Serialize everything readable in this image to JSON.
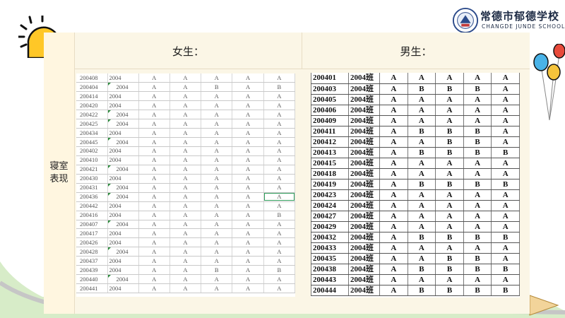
{
  "logo": {
    "name_cn": "常德市郁德学校",
    "name_en": "CHANGDE JUNDE SCHOOL"
  },
  "row_label": "寝室表现",
  "headers": {
    "female": "女生：",
    "male": "男生："
  },
  "female_table": {
    "rows": [
      [
        "200408",
        "2004",
        "A",
        "A",
        "A",
        "A",
        "A"
      ],
      [
        "200404",
        "2004",
        "A",
        "A",
        "B",
        "A",
        "B"
      ],
      [
        "200414",
        "2004",
        "A",
        "A",
        "A",
        "A",
        "A"
      ],
      [
        "200420",
        "2004",
        "A",
        "A",
        "A",
        "A",
        "A"
      ],
      [
        "200422",
        "2004",
        "A",
        "A",
        "A",
        "A",
        "A"
      ],
      [
        "200425",
        "2004",
        "A",
        "A",
        "A",
        "A",
        "A"
      ],
      [
        "200434",
        "2004",
        "A",
        "A",
        "A",
        "A",
        "A"
      ],
      [
        "200445",
        "2004",
        "A",
        "A",
        "A",
        "A",
        "A"
      ],
      [
        "200402",
        "2004",
        "A",
        "A",
        "A",
        "A",
        "A"
      ],
      [
        "200410",
        "2004",
        "A",
        "A",
        "A",
        "A",
        "A"
      ],
      [
        "200421",
        "2004",
        "A",
        "A",
        "A",
        "A",
        "A"
      ],
      [
        "200430",
        "2004",
        "A",
        "A",
        "A",
        "A",
        "A"
      ],
      [
        "200431",
        "2004",
        "A",
        "A",
        "A",
        "A",
        "A"
      ],
      [
        "200436",
        "2004",
        "A",
        "A",
        "A",
        "A",
        "A"
      ],
      [
        "200442",
        "2004",
        "A",
        "A",
        "A",
        "A",
        "A"
      ],
      [
        "200416",
        "2004",
        "A",
        "A",
        "A",
        "A",
        "B"
      ],
      [
        "200407",
        "2004",
        "A",
        "A",
        "A",
        "A",
        "A"
      ],
      [
        "200417",
        "2004",
        "A",
        "A",
        "A",
        "A",
        "A"
      ],
      [
        "200426",
        "2004",
        "A",
        "A",
        "A",
        "A",
        "A"
      ],
      [
        "200428",
        "2004",
        "A",
        "A",
        "A",
        "A",
        "A"
      ],
      [
        "200437",
        "2004",
        "A",
        "A",
        "A",
        "A",
        "A"
      ],
      [
        "200439",
        "2004",
        "A",
        "A",
        "B",
        "A",
        "B"
      ],
      [
        "200440",
        "2004",
        "A",
        "A",
        "A",
        "A",
        "A"
      ],
      [
        "200441",
        "2004",
        "A",
        "A",
        "A",
        "A",
        "A"
      ]
    ]
  },
  "male_table": {
    "rows": [
      [
        "200401",
        "2004班",
        "A",
        "A",
        "A",
        "A",
        "A"
      ],
      [
        "200403",
        "2004班",
        "A",
        "B",
        "B",
        "B",
        "A"
      ],
      [
        "200405",
        "2004班",
        "A",
        "A",
        "A",
        "A",
        "A"
      ],
      [
        "200406",
        "2004班",
        "A",
        "A",
        "A",
        "A",
        "A"
      ],
      [
        "200409",
        "2004班",
        "A",
        "A",
        "A",
        "A",
        "A"
      ],
      [
        "200411",
        "2004班",
        "A",
        "B",
        "B",
        "B",
        "A"
      ],
      [
        "200412",
        "2004班",
        "A",
        "A",
        "B",
        "B",
        "A"
      ],
      [
        "200413",
        "2004班",
        "A",
        "B",
        "B",
        "B",
        "B"
      ],
      [
        "200415",
        "2004班",
        "A",
        "A",
        "A",
        "A",
        "A"
      ],
      [
        "200418",
        "2004班",
        "A",
        "A",
        "A",
        "A",
        "A"
      ],
      [
        "200419",
        "2004班",
        "A",
        "B",
        "B",
        "B",
        "B"
      ],
      [
        "200423",
        "2004班",
        "A",
        "A",
        "A",
        "A",
        "A"
      ],
      [
        "200424",
        "2004班",
        "A",
        "A",
        "A",
        "A",
        "A"
      ],
      [
        "200427",
        "2004班",
        "A",
        "A",
        "A",
        "A",
        "A"
      ],
      [
        "200429",
        "2004班",
        "A",
        "A",
        "A",
        "A",
        "A"
      ],
      [
        "200432",
        "2004班",
        "A",
        "B",
        "B",
        "B",
        "B"
      ],
      [
        "200433",
        "2004班",
        "A",
        "A",
        "A",
        "A",
        "A"
      ],
      [
        "200435",
        "2004班",
        "A",
        "A",
        "B",
        "B",
        "A"
      ],
      [
        "200438",
        "2004班",
        "A",
        "B",
        "B",
        "B",
        "B"
      ],
      [
        "200443",
        "2004班",
        "A",
        "A",
        "A",
        "A",
        "A"
      ],
      [
        "200444",
        "2004班",
        "A",
        "B",
        "B",
        "B",
        "B"
      ]
    ]
  }
}
